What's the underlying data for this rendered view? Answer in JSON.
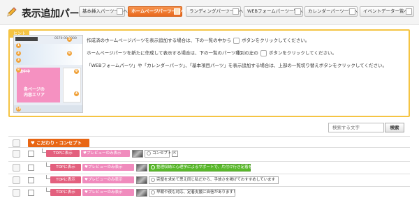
{
  "header": {
    "title": "表示追加パーツ選",
    "tabs": [
      {
        "label": "基本挿入パーツ一覧へ",
        "active": false
      },
      {
        "label": "ホームページパーツ一覧へ",
        "active": true
      },
      {
        "label": "ランディングパーツ一覧へ",
        "active": false
      },
      {
        "label": "WEBフォームパーツ一覧へ",
        "active": false
      },
      {
        "label": "カレンダーパーツ一覧へ",
        "active": false
      },
      {
        "label": "イベントデーター覧へ",
        "active": false
      }
    ]
  },
  "help": {
    "hint_label": "ヒント",
    "thumbnail": {
      "tel": "0570-00-0000",
      "pink_label_1": "各ページの",
      "pink_label_2": "内容エリア",
      "pink_heading": "途中中"
    },
    "line1_a": "作成済のホームページパーツを表示追加する場合は、下の一覧の中から",
    "line1_b": "ボタンをクリックしてください。",
    "line2_a": "ホームページパーツを新たに作成して表示する場合は、下の一覧のパーツ種別の左の",
    "line2_b": "ボタンをクリックしてください。",
    "line3": "「WEBフォームパーツ」や「カレンダーパーツ」、「基本項目パーツ」を表示追加する場合は、上部の一覧切り替えボタンをクリックしてください。"
  },
  "search": {
    "placeholder": "検索する文字",
    "button": "検索"
  },
  "section": {
    "label": "こだわり・コンセプト"
  },
  "rows": [
    {
      "tag1": "TOPに表示",
      "tag2": "プレビューのみ表示",
      "text": "コンセプト",
      "highlight": false
    },
    {
      "tag1": "TOPに表示",
      "tag2": "プレビューのみ表示",
      "text": "整理収納と心理学によるサポートで、片付け行き定着を",
      "highlight": true
    },
    {
      "tag1": "TOPに表示",
      "tag2": "プレビューのみ表示",
      "text": "完璧を求めて思え同じ私だから、手放さを掲げておすすめしています",
      "highlight": false
    },
    {
      "tag1": "TOPに表示",
      "tag2": "プレビューのみ表示",
      "text": "早朝や夜も対応、定着支援に自信があります！",
      "highlight": false
    }
  ],
  "colors": {
    "accent": "#e8691f",
    "help_border": "#f5c443",
    "tag_top": "#e3607e",
    "tag_preview": "#f08bbd",
    "highlight": "#59b82b"
  }
}
